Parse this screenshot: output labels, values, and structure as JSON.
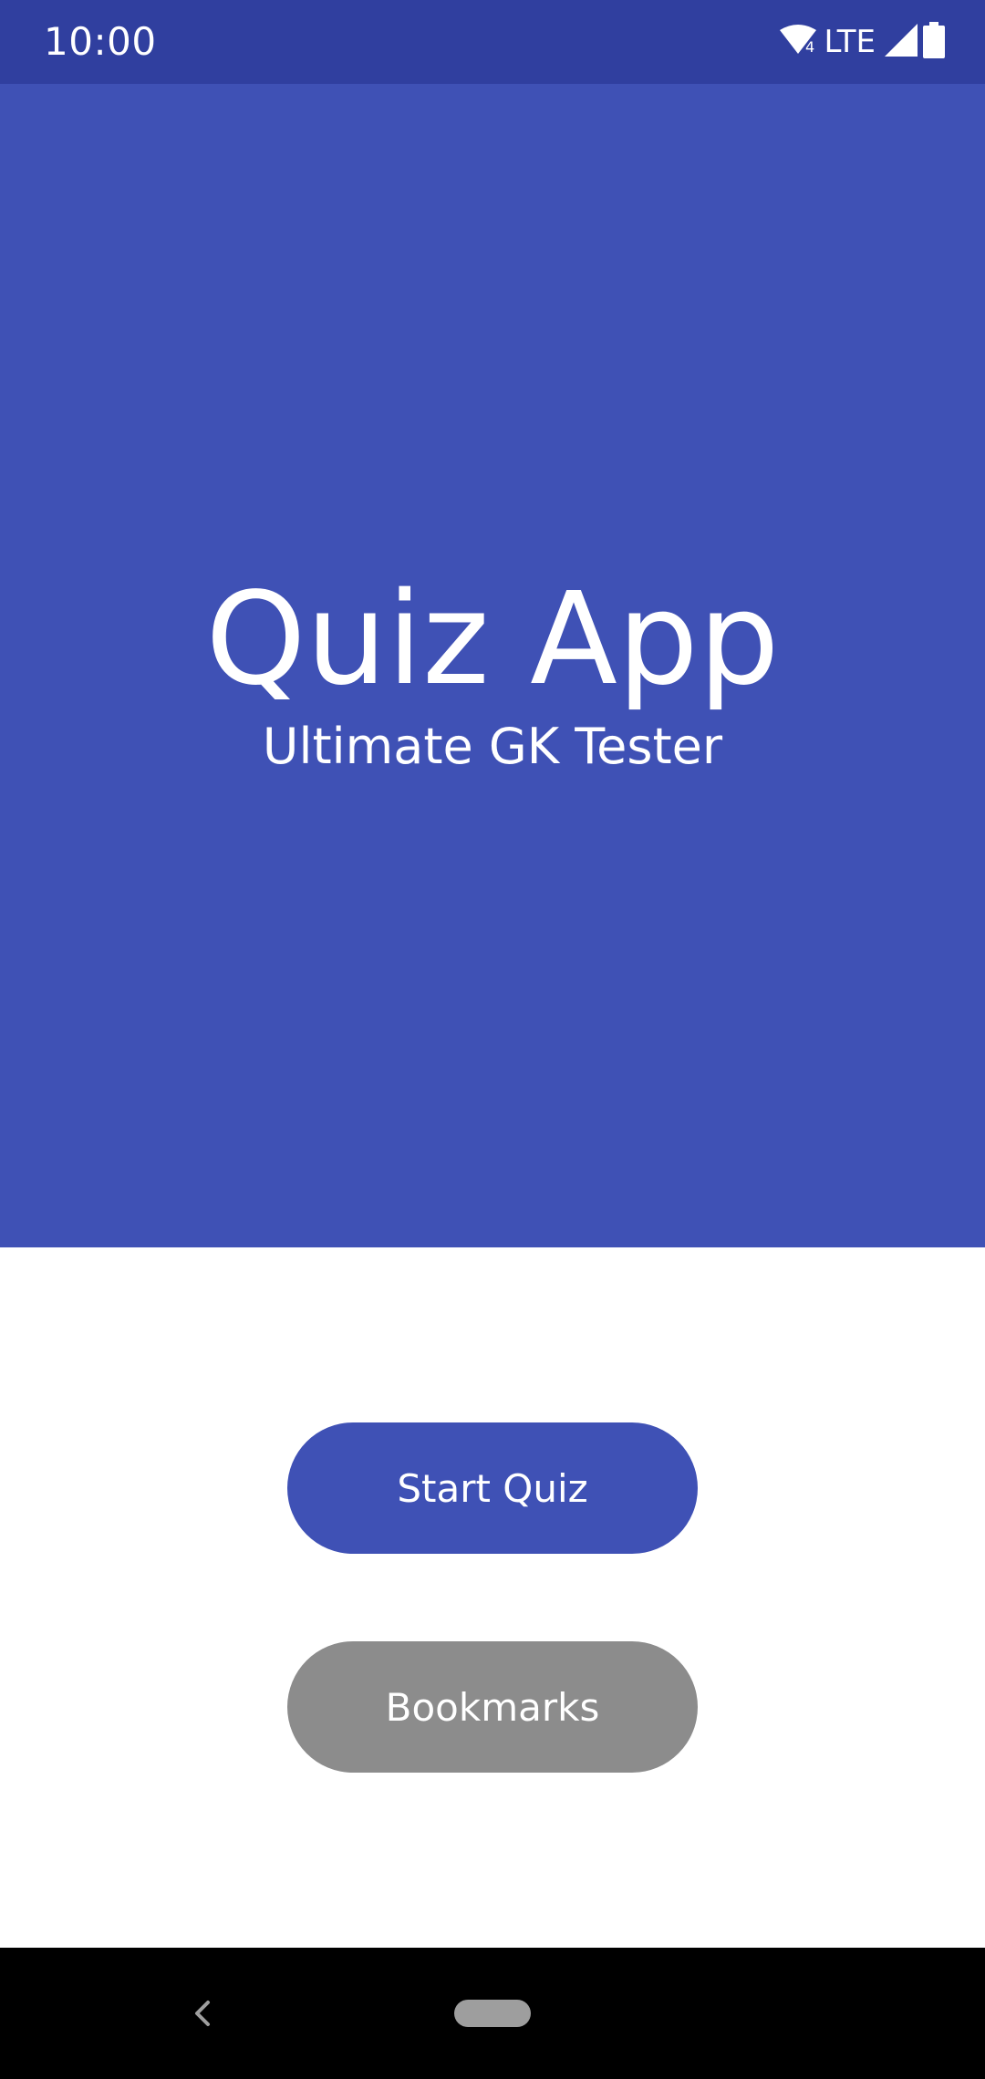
{
  "status_bar": {
    "time": "10:00",
    "network_label": "LTE",
    "icons": [
      "wifi-icon",
      "cell-signal-icon",
      "battery-icon"
    ]
  },
  "hero": {
    "title": "Quiz App",
    "subtitle": "Ultimate GK Tester"
  },
  "buttons": {
    "start_label": "Start Quiz",
    "bookmarks_label": "Bookmarks"
  },
  "nav_bar": {
    "icons": [
      "back-icon",
      "home-pill-icon"
    ]
  },
  "colors": {
    "status_bar": "#303F9F",
    "primary": "#3F51B5",
    "secondary_button": "#8C8C8C",
    "nav_bar": "#000000"
  }
}
